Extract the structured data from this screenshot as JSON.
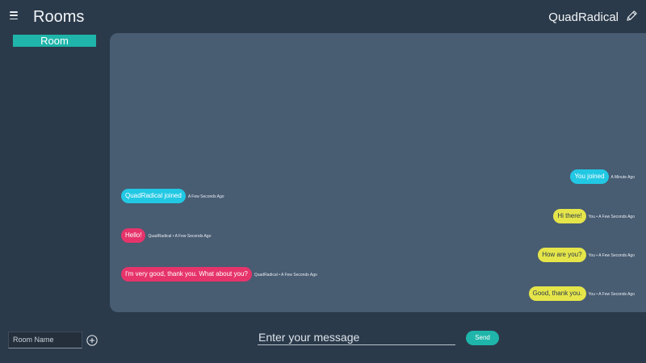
{
  "header": {
    "title": "Rooms",
    "username": "QuadRadical"
  },
  "sidebar": {
    "rooms": [
      {
        "label": "Room",
        "active": true
      }
    ]
  },
  "chat": {
    "messages": [
      {
        "text": "You joined",
        "meta": "A Minute Ago",
        "side": "right",
        "color": "cyan"
      },
      {
        "text": "QuadRadical joined",
        "meta": "A Few Seconds Ago",
        "side": "left",
        "color": "cyan"
      },
      {
        "text": "Hi there!",
        "meta": "You • A Few Seconds Ago",
        "side": "right",
        "color": "yellow"
      },
      {
        "text": "Hello!",
        "meta": "QuadRadical • A Few Seconds Ago",
        "side": "left",
        "color": "pink"
      },
      {
        "text": "How are you?",
        "meta": "You • A Few Seconds Ago",
        "side": "right",
        "color": "yellow"
      },
      {
        "text": "I'm very good, thank you. What about you?",
        "meta": "QuadRadical • A Few Seconds Ago",
        "side": "left",
        "color": "pink"
      },
      {
        "text": "Good, thank you.",
        "meta": "You • A Few Seconds Ago",
        "side": "right",
        "color": "yellow"
      }
    ]
  },
  "footer": {
    "room_name_placeholder": "Room Name",
    "message_placeholder": "Enter your message",
    "send_label": "Send"
  },
  "colors": {
    "background": "#2b3a4a",
    "panel": "#485c72",
    "accent": "#1fb5aa",
    "cyan_bubble": "#22c8e3",
    "yellow_bubble": "#e5e54a",
    "pink_bubble": "#e6346b"
  },
  "icons": {
    "menu": "menu-icon",
    "edit": "pencil-icon",
    "add": "add-circle-icon"
  }
}
